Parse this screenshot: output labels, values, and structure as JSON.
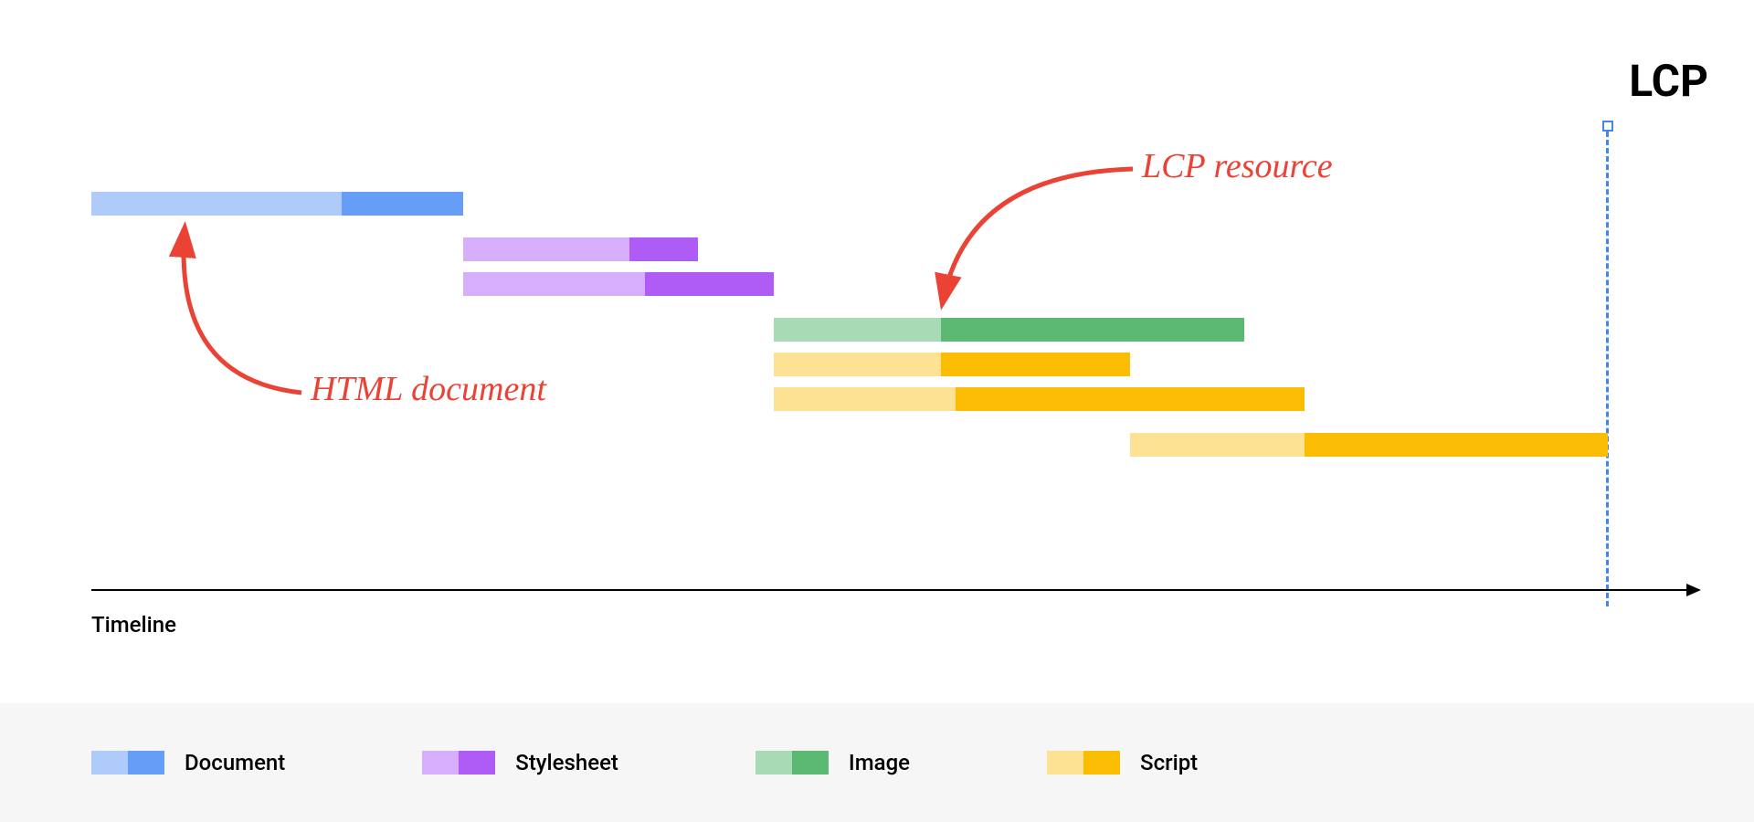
{
  "chart_data": {
    "type": "gantt",
    "title": "",
    "xlabel": "Timeline",
    "ylabel": "",
    "xlim": [
      0,
      100
    ],
    "lcp_marker": 100,
    "resources": [
      {
        "name": "Document",
        "category": "document",
        "start": 0,
        "light_end": 16.5,
        "end": 24.5
      },
      {
        "name": "Stylesheet",
        "category": "stylesheet",
        "start": 24.5,
        "light_end": 35.5,
        "end": 40
      },
      {
        "name": "Stylesheet",
        "category": "stylesheet",
        "start": 24.5,
        "light_end": 36.5,
        "end": 45
      },
      {
        "name": "Image",
        "category": "image",
        "start": 45,
        "light_end": 56,
        "end": 76
      },
      {
        "name": "Script",
        "category": "script",
        "start": 45,
        "light_end": 56,
        "end": 68.5
      },
      {
        "name": "Script",
        "category": "script",
        "start": 45,
        "light_end": 57,
        "end": 80
      },
      {
        "name": "Script",
        "category": "script",
        "start": 68.5,
        "light_end": 80,
        "end": 100
      }
    ],
    "categories": {
      "document": {
        "light": "#aecbfa",
        "dark": "#669df6"
      },
      "stylesheet": {
        "light": "#d7aefb",
        "dark": "#af5cf7"
      },
      "image": {
        "light": "#a8dab5",
        "dark": "#5bb974"
      },
      "script": {
        "light": "#fde293",
        "dark": "#fbbc04"
      }
    }
  },
  "labels": {
    "lcp": "LCP",
    "timeline": "Timeline"
  },
  "annotations": {
    "html_document": "HTML document",
    "lcp_resource": "LCP resource"
  },
  "legend": [
    {
      "key": "document",
      "label": "Document"
    },
    {
      "key": "stylesheet",
      "label": "Stylesheet"
    },
    {
      "key": "image",
      "label": "Image"
    },
    {
      "key": "script",
      "label": "Script"
    }
  ],
  "colors": {
    "annotation_red": "#ea4335",
    "marker_blue": "#4285f4",
    "legend_bg": "#f6f6f6"
  }
}
